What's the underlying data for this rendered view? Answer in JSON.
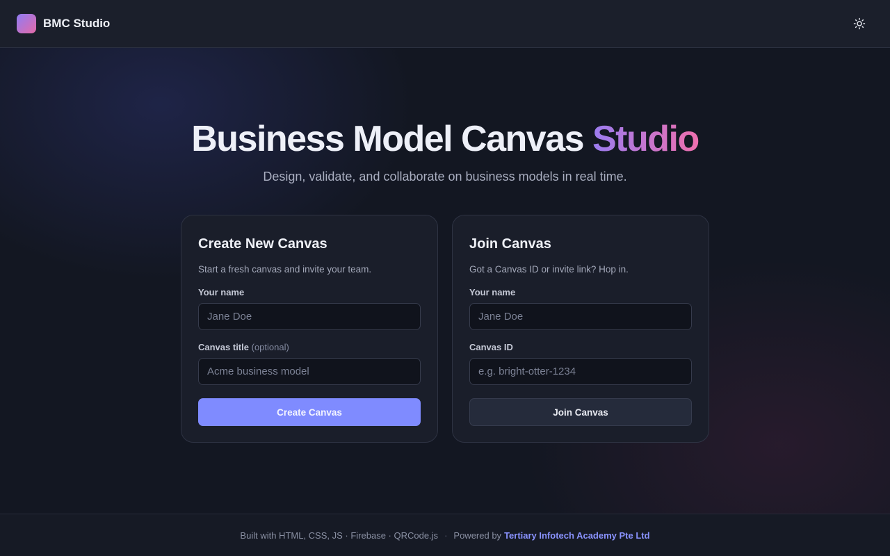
{
  "header": {
    "brand": "BMC Studio",
    "theme_toggle_icon": "sun-icon"
  },
  "hero": {
    "title_main": "Business Model Canvas",
    "title_accent": "Studio",
    "subtitle": "Design, validate, and collaborate on business models in real time."
  },
  "create_card": {
    "title": "Create New Canvas",
    "description": "Start a fresh canvas and invite your team.",
    "name_label": "Your name",
    "name_placeholder": "Jane Doe",
    "name_value": "",
    "canvas_title_label": "Canvas title",
    "canvas_title_optional": "(optional)",
    "canvas_title_placeholder": "Acme business model",
    "canvas_title_value": "",
    "button_label": "Create Canvas"
  },
  "join_card": {
    "title": "Join Canvas",
    "description": "Got a Canvas ID or invite link? Hop in.",
    "name_label": "Your name",
    "name_placeholder": "Jane Doe",
    "name_value": "",
    "canvas_id_label": "Canvas ID",
    "canvas_id_placeholder": "e.g. bright-otter-1234",
    "canvas_id_value": "",
    "button_label": "Join Canvas"
  },
  "footer": {
    "built_with": "Built with HTML, CSS, JS · Firebase · QRCode.js",
    "separator": "·",
    "powered_by": "Powered by",
    "company": "Tertiary Infotech Academy Pte Ltd"
  },
  "colors": {
    "accent": "#7f8bff",
    "background": "#131722",
    "card": "#1a1e2a",
    "title_gradient_start": "#9b7cf0",
    "title_gradient_end": "#ee6fae"
  }
}
